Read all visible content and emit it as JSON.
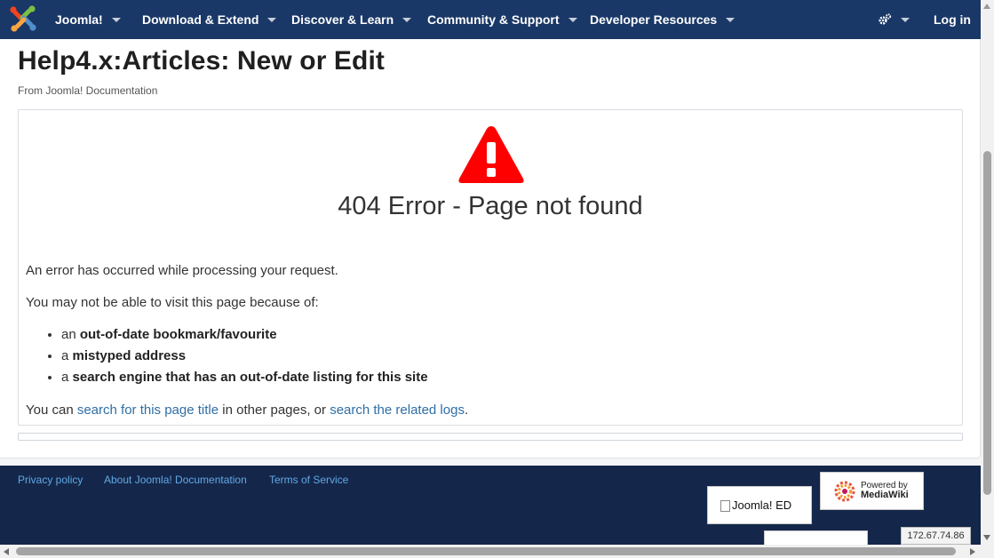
{
  "nav": {
    "logo_icon": "joomla-logo-icon",
    "items": [
      {
        "label": "Joomla!"
      },
      {
        "label": "Download & Extend"
      },
      {
        "label": "Discover & Learn"
      },
      {
        "label": "Community & Support"
      },
      {
        "label": "Developer Resources"
      }
    ],
    "settings_icon": "gears-icon",
    "login": "Log in"
  },
  "page": {
    "title": "Help4.x:Articles: New or Edit",
    "from": "From Joomla! Documentation"
  },
  "error": {
    "icon": "warning-triangle-icon",
    "icon_color": "#ff0000",
    "heading": "404 Error - Page not found",
    "p1": "An error has occurred while processing your request.",
    "p2": "You may not be able to visit this page because of:",
    "reasons": [
      {
        "prefix": "an ",
        "bold": "out-of-date bookmark/favourite"
      },
      {
        "prefix": "a ",
        "bold": "mistyped address"
      },
      {
        "prefix": "a ",
        "bold": "search engine that has an out-of-date listing for this site"
      }
    ],
    "p3_prefix": "You can ",
    "p3_link1": "search for this page title",
    "p3_mid": " in other pages, or ",
    "p3_link2": "search the related logs",
    "p3_suffix": "."
  },
  "footer": {
    "links": [
      "Privacy policy",
      "About Joomla! Documentation",
      "Terms of Service"
    ],
    "badge_joomla_alt": "Joomla! ED",
    "badge_mw_line1": "Powered by",
    "badge_mw_line2": "MediaWiki",
    "ip": "172.67.74.86"
  },
  "colors": {
    "nav_bg": "#1a3867",
    "footer_bg": "#14274a",
    "link": "#2e6ea6",
    "footer_link": "#62a8e5"
  }
}
